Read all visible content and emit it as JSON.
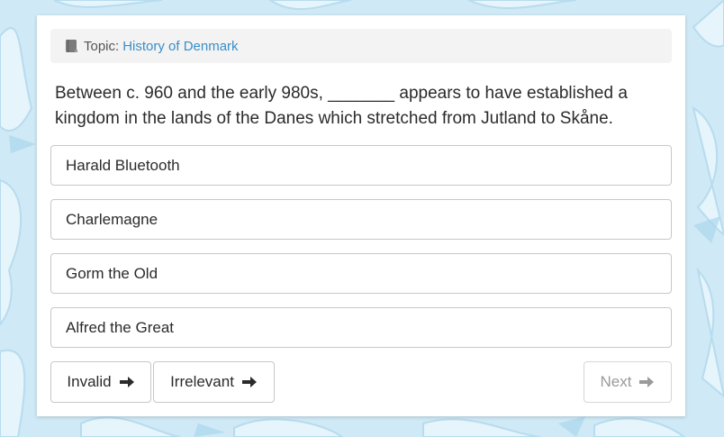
{
  "topic": {
    "label": "Topic:",
    "value": "History of Denmark",
    "icon": "book-icon"
  },
  "question": {
    "text": "Between c. 960 and the early 980s, _______ appears to have established a kingdom in the lands of the Danes which stretched from Jutland to Skåne."
  },
  "options": [
    {
      "label": "Harald Bluetooth"
    },
    {
      "label": "Charlemagne"
    },
    {
      "label": "Gorm the Old"
    },
    {
      "label": "Alfred the Great"
    }
  ],
  "buttons": {
    "invalid_label": "Invalid",
    "irrelevant_label": "Irrelevant",
    "next_label": "Next",
    "arrow_icon": "arrow-right-icon"
  },
  "colors": {
    "background": "#cfe9f6",
    "link": "#3a8fc7",
    "topic_bar": "#f3f3f3",
    "border": "#c8c8c8"
  }
}
